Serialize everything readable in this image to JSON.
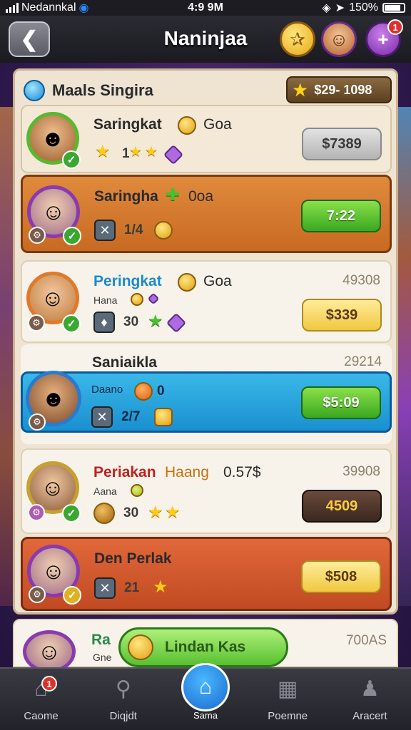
{
  "status_bar": {
    "carrier": "Nedannkal",
    "time": "4:9 9M",
    "battery": "150%"
  },
  "header": {
    "title": "Naninjaa",
    "gift_badge": "1"
  },
  "panel": {
    "title": "Maals Singira",
    "currency": "$29- 1098"
  },
  "rows": [
    {
      "name": "Saringkat",
      "tag": "Goa",
      "sub": "1",
      "button": "$7389",
      "rank": ""
    },
    {
      "name": "Saringha",
      "tag": "0oa",
      "sub": "1/4",
      "button": "7:22",
      "rank": ""
    },
    {
      "name": "Peringkat",
      "tag": "Goa",
      "label": "Hana",
      "sub": "30",
      "button": "$339",
      "rank": "49308"
    },
    {
      "name": "Saniaikla",
      "tag": "",
      "label": "Daano",
      "sub": "2/7",
      "extra": "0",
      "button": "$5:09",
      "rank": "29214"
    },
    {
      "name": "Periakan",
      "tag": "Haang",
      "tag2": "0.57$",
      "label": "Aana",
      "sub": "30",
      "button": "4509",
      "rank": "39908"
    },
    {
      "name": "Den Perlak",
      "tag": "",
      "sub": "21",
      "button": "$508",
      "rank": ""
    },
    {
      "name": "Ra",
      "label": "Gne",
      "rank": "700AS"
    }
  ],
  "claim_button": {
    "label": "Lindan Kas"
  },
  "bottom_nav": [
    {
      "label": "Caome",
      "icon": "home-icon",
      "badge": "1"
    },
    {
      "label": "Diqjdt",
      "icon": "search-icon"
    },
    {
      "label": "Sama",
      "icon": "home-icon"
    },
    {
      "label": "Poemne",
      "icon": "grid-icon"
    },
    {
      "label": "Aracert",
      "icon": "user-icon"
    }
  ]
}
